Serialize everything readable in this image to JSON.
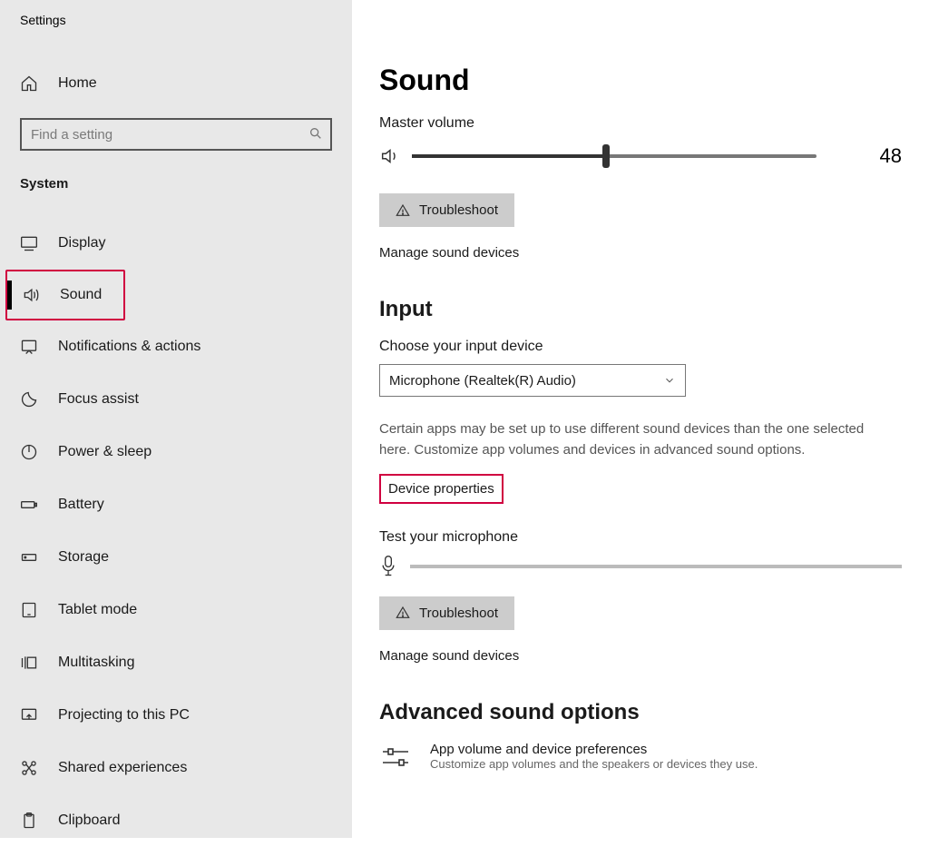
{
  "sidebar": {
    "app_title": "Settings",
    "home_label": "Home",
    "search_placeholder": "Find a setting",
    "category": "System",
    "items": [
      {
        "id": "display",
        "label": "Display"
      },
      {
        "id": "sound",
        "label": "Sound",
        "selected": true
      },
      {
        "id": "notifications",
        "label": "Notifications & actions"
      },
      {
        "id": "focus",
        "label": "Focus assist"
      },
      {
        "id": "power",
        "label": "Power & sleep"
      },
      {
        "id": "battery",
        "label": "Battery"
      },
      {
        "id": "storage",
        "label": "Storage"
      },
      {
        "id": "tablet",
        "label": "Tablet mode"
      },
      {
        "id": "multitask",
        "label": "Multitasking"
      },
      {
        "id": "projecting",
        "label": "Projecting to this PC"
      },
      {
        "id": "shared",
        "label": "Shared experiences"
      },
      {
        "id": "clipboard",
        "label": "Clipboard"
      }
    ]
  },
  "main": {
    "title": "Sound",
    "master_volume_label": "Master volume",
    "master_volume_value": "48",
    "master_volume_percent": 48,
    "troubleshoot_label": "Troubleshoot",
    "manage_label": "Manage sound devices",
    "input": {
      "heading": "Input",
      "choose_label": "Choose your input device",
      "selected_device": "Microphone (Realtek(R) Audio)",
      "help_text": "Certain apps may be set up to use different sound devices than the one selected here. Customize app volumes and devices in advanced sound options.",
      "device_properties_label": "Device properties",
      "test_label": "Test your microphone",
      "troubleshoot_label": "Troubleshoot",
      "manage_label": "Manage sound devices"
    },
    "advanced": {
      "heading": "Advanced sound options",
      "app_vol_title": "App volume and device preferences",
      "app_vol_sub": "Customize app volumes and the speakers or devices they use."
    }
  },
  "highlights": {
    "sound_nav": true,
    "device_properties": true
  }
}
